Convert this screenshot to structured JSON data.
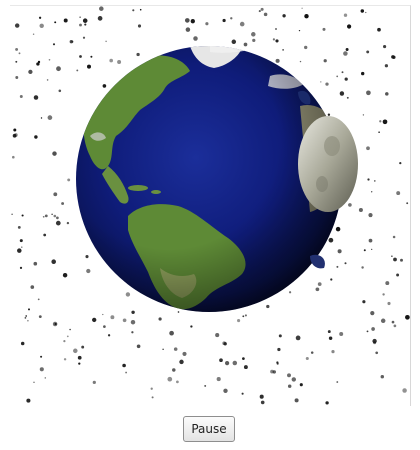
{
  "controls": {
    "pause_label": "Pause"
  },
  "scene": {
    "subject": "earth-globe",
    "background_color": "#ffffff",
    "star_color": "#111111",
    "ocean_color": "#0d1a6e",
    "land_color": "#5e8a36",
    "cloud_color": "#e6e6e6"
  }
}
